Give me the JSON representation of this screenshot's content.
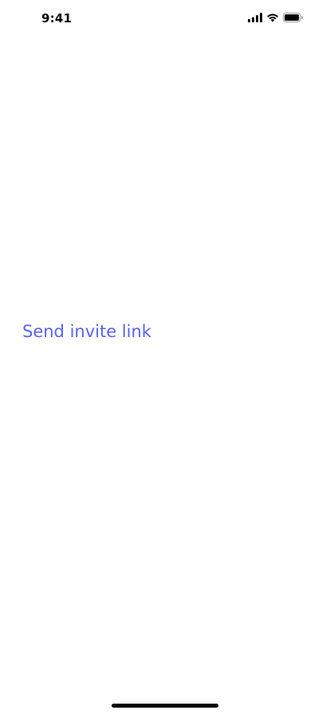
{
  "status_bar": {
    "time": "9:41",
    "icons": [
      "cellular-signal-icon",
      "wifi-icon",
      "battery-icon"
    ]
  },
  "main": {
    "invite_link_label": "Send invite link"
  },
  "colors": {
    "link": "#5b63f0",
    "background": "#ffffff",
    "status_text": "#000000"
  }
}
